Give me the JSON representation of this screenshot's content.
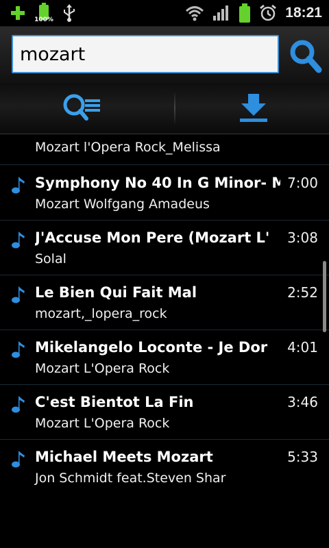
{
  "status_bar": {
    "battery_percent": "100%",
    "time": "18:21"
  },
  "search": {
    "query": "mozart"
  },
  "toolbar": {
    "left_icon": "search-list-icon",
    "right_icon": "download-icon"
  },
  "results": {
    "partial_artist": "Mozart l'Opera Rock_Melissa",
    "items": [
      {
        "title": "Symphony No 40 In G Minor- M",
        "artist": "Mozart Wolfgang Amadeus",
        "duration": "7:00"
      },
      {
        "title": "J'Accuse Mon Pere (Mozart L'",
        "artist": "Solal",
        "duration": "3:08"
      },
      {
        "title": "Le Bien Qui Fait Mal",
        "artist": "mozart,_lopera_rock",
        "duration": "2:52"
      },
      {
        "title": "Mikelangelo Loconte - Je Dor",
        "artist": "Mozart L'Opera Rock",
        "duration": "4:01"
      },
      {
        "title": "C'est Bientot La Fin",
        "artist": "Mozart L'Opera Rock",
        "duration": "3:46"
      },
      {
        "title": "Michael Meets Mozart",
        "artist": "Jon Schmidt feat.Steven Shar",
        "duration": "5:33"
      }
    ]
  },
  "colors": {
    "accent": "#2e8ee0",
    "status_green": "#64d12c"
  }
}
